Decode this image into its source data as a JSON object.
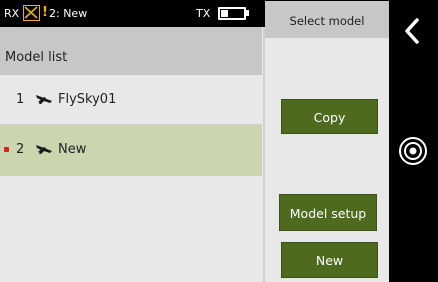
{
  "status_bar": {
    "rx_label": "RX",
    "warn_symbol": "!",
    "model_status": "2: New",
    "tx_label": "TX",
    "tx_battery_level": 0.3
  },
  "title": "Select model",
  "list": {
    "header": "Model list",
    "items": [
      {
        "number": "1",
        "name": "FlySky01",
        "icon": "airplane-icon",
        "selected": false,
        "active": false
      },
      {
        "number": "2",
        "name": "New",
        "icon": "airplane-icon",
        "selected": true,
        "active": true
      }
    ]
  },
  "buttons": {
    "copy": "Copy",
    "model_setup": "Model setup",
    "new": "New"
  },
  "icons": {
    "back": "chevron-left-icon",
    "scroll": "scroll-wheel-icon",
    "rx_signal": "rx-no-signal-icon",
    "battery": "battery-icon"
  },
  "colors": {
    "button_green": "#4d6a1e",
    "selected_row": "#c9d6b0",
    "active_dot": "#e31b1b",
    "warning": "#f0b000"
  }
}
